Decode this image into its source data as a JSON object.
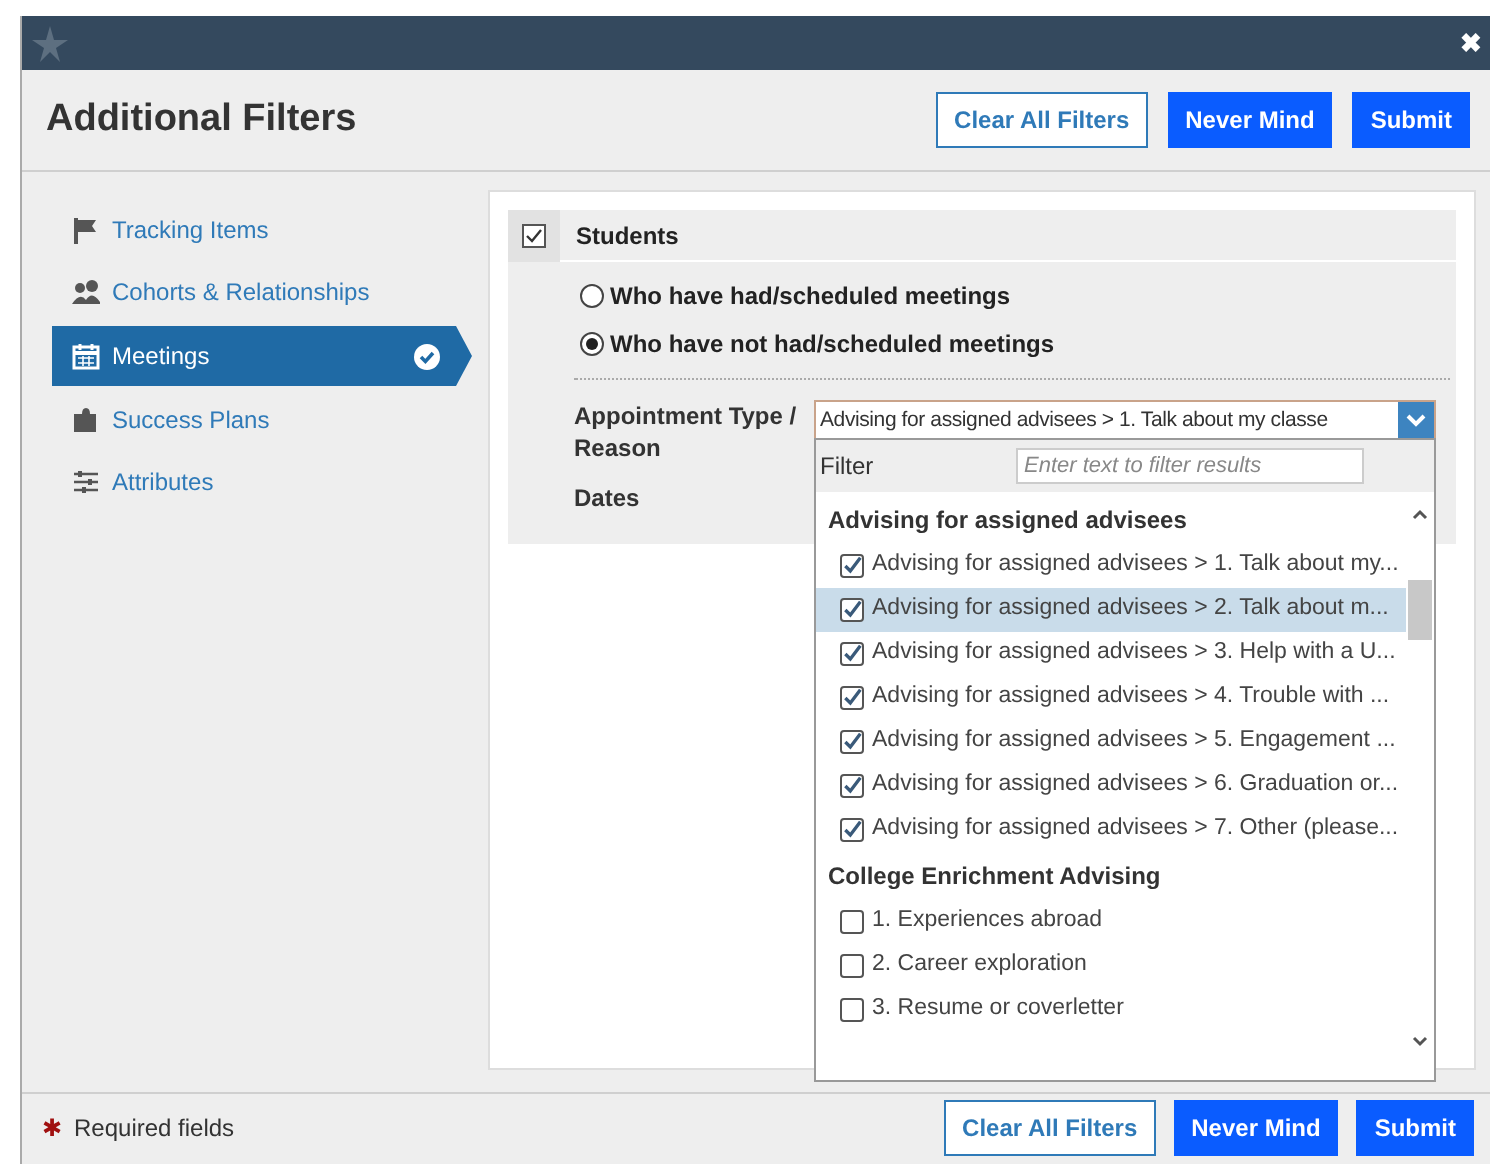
{
  "window": {
    "title": "Additional Filters",
    "close": "✖"
  },
  "header_buttons": [
    {
      "label": "Clear All Filters",
      "kind": "outline"
    },
    {
      "label": "Never Mind",
      "kind": "primary"
    },
    {
      "label": "Submit",
      "kind": "primary"
    }
  ],
  "sidebar": {
    "items": [
      {
        "label": "Tracking Items",
        "selected": false
      },
      {
        "label": "Cohorts & Relationships",
        "selected": false
      },
      {
        "label": "Meetings",
        "selected": true
      },
      {
        "label": "Success Plans",
        "selected": false
      },
      {
        "label": "Attributes",
        "selected": false
      }
    ]
  },
  "section": {
    "title": "Students",
    "checked": true,
    "radios": [
      {
        "label": "Who have had/scheduled meetings",
        "selected": false
      },
      {
        "label": "Who have **not** had/scheduled meetings",
        "selected": true
      }
    ],
    "fields": [
      {
        "label": "Appointment Type / Reason"
      },
      {
        "label": "Dates"
      }
    ],
    "select": {
      "value": "Advising for assigned advisees > 1. Talk about my classe"
    },
    "dropdown": {
      "filter_label": "Filter",
      "filter_placeholder": "Enter text to filter results",
      "groups": [
        {
          "title": "Advising for assigned advisees",
          "options": [
            {
              "label": "Advising for assigned advisees > 1. Talk about my...",
              "checked": true,
              "selected": false
            },
            {
              "label": "Advising for assigned advisees > 2. Talk about m...",
              "checked": true,
              "selected": true
            },
            {
              "label": "Advising for assigned advisees > 3. Help with a U...",
              "checked": true,
              "selected": false
            },
            {
              "label": "Advising for assigned advisees > 4. Trouble with ...",
              "checked": true,
              "selected": false
            },
            {
              "label": "Advising for assigned advisees > 5. Engagement ...",
              "checked": true,
              "selected": false
            },
            {
              "label": "Advising for assigned advisees > 6. Graduation or...",
              "checked": true,
              "selected": false
            },
            {
              "label": "Advising for assigned advisees > 7. Other (please...",
              "checked": true,
              "selected": false
            }
          ]
        },
        {
          "title": "College Enrichment Advising",
          "options": [
            {
              "label": "1. Experiences abroad",
              "checked": false,
              "selected": false
            },
            {
              "label": "2. Career exploration",
              "checked": false,
              "selected": false
            },
            {
              "label": "3. Resume or coverletter",
              "checked": false,
              "selected": false
            }
          ]
        }
      ]
    }
  },
  "footer": {
    "required_mark": "✱",
    "required_note": "Required fields",
    "buttons": [
      {
        "label": "Clear All Filters",
        "kind": "outline"
      },
      {
        "label": "Never Mind",
        "kind": "primary"
      },
      {
        "label": "Submit",
        "kind": "primary"
      }
    ]
  }
}
